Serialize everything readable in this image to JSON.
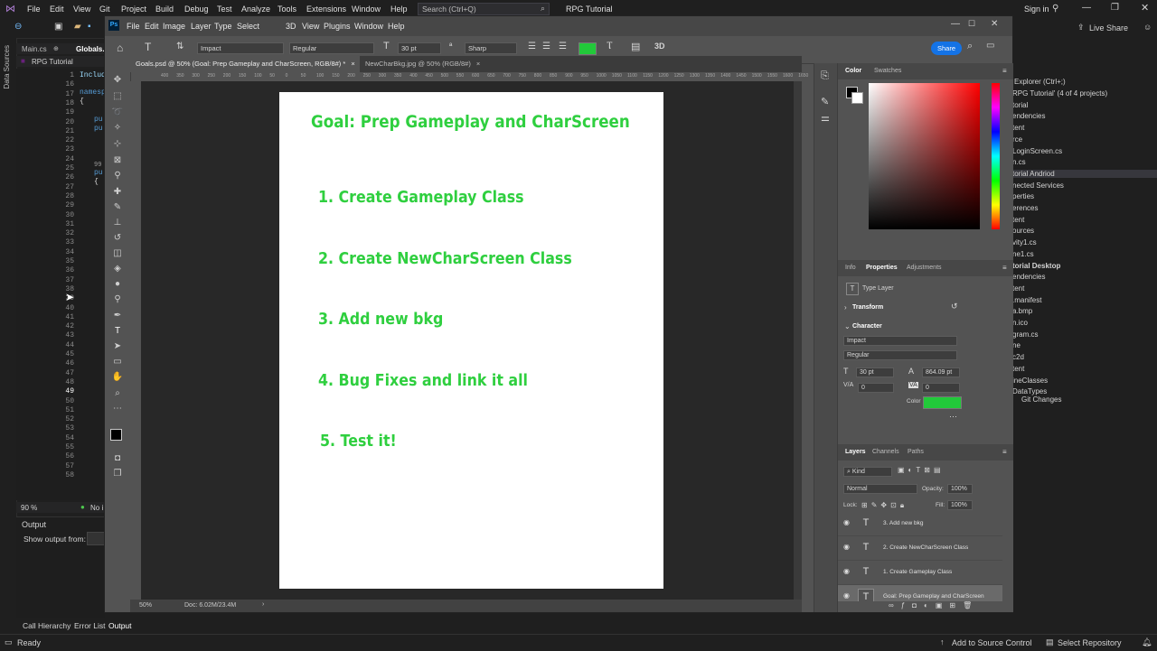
{
  "vs": {
    "menu": [
      "File",
      "Edit",
      "View",
      "Git",
      "Project",
      "Build",
      "Debug",
      "Test",
      "Analyze",
      "Tools",
      "Extensions",
      "Window",
      "Help"
    ],
    "search_placeholder": "Search (Ctrl+Q)",
    "title": "RPG Tutorial",
    "sign_in": "Sign in",
    "live_share": "Live Share",
    "left_strip_label": "Data Sources",
    "editor_tabs": [
      "Main.cs",
      "Globals.c"
    ],
    "file_dropdown": "RPG Tutorial",
    "code_fragments": {
      "include": "Includ",
      "namespace": "namesp",
      "brace_open": "{",
      "pu1": "pu",
      "pu2": "pu",
      "n99": "99",
      "pu3": "pu",
      "brace2": "{"
    },
    "line_numbers": [
      "1",
      "16",
      "17",
      "18",
      "19",
      "20",
      "21",
      "22",
      "23",
      "24",
      "25",
      "26",
      "27",
      "28",
      "29",
      "30",
      "31",
      "32",
      "33",
      "34",
      "35",
      "36",
      "37",
      "38",
      "39",
      "40",
      "41",
      "42",
      "43",
      "44",
      "45",
      "46",
      "47",
      "48",
      "49",
      "50",
      "51",
      "52",
      "53",
      "54",
      "55",
      "56",
      "57",
      "58"
    ],
    "zoom": "90 %",
    "issues": "No i",
    "output_title": "Output",
    "output_from": "Show output from:",
    "bottom_tabs": [
      "Call Hierarchy",
      "Error List",
      "Output"
    ],
    "status_ready": "Ready",
    "add_source": "Add to Source Control",
    "select_repo": "Select Repository",
    "solution_search": "Explorer (Ctrl+;)",
    "solution_items": [
      "RPG Tutorial' (4 of 4 projects)",
      "torial",
      "endencies",
      "tent",
      "rce",
      "LoginScreen.cs",
      "n.cs",
      "torial Andriod",
      "nected Services",
      "perties",
      "erences",
      "tent",
      "ources",
      "vity1.cs",
      "ne1.cs",
      "torial Desktop",
      "endencies",
      "tent",
      ".manifest",
      "a.bmp",
      "n.ico",
      "gram.cs",
      "ne",
      "c2d",
      "tent",
      "ineClasses",
      "DataTypes"
    ],
    "git_changes": "Git Changes"
  },
  "ps": {
    "menu": [
      "File",
      "Edit",
      "Image",
      "Layer",
      "Type",
      "Select",
      "3D",
      "View",
      "Plugins",
      "Window",
      "Help"
    ],
    "options": {
      "font": "Impact",
      "style": "Regular",
      "size": "30 pt",
      "aa": "Sharp",
      "share": "Share",
      "color": "#22c93a"
    },
    "doc_tabs": [
      {
        "label": "Goals.psd @ 50% (Goal: Prep Gameplay and CharScreen, RGB/8#) *",
        "close": "×"
      },
      {
        "label": "NewCharBkg.jpg @ 50% (RGB/8#)",
        "close": "×"
      }
    ],
    "ruler_ticks": [
      "400",
      "350",
      "300",
      "250",
      "200",
      "150",
      "100",
      "50",
      "0",
      "50",
      "100",
      "150",
      "200",
      "250",
      "300",
      "350",
      "400",
      "450",
      "500",
      "550",
      "600",
      "650",
      "700",
      "750",
      "800",
      "850",
      "900",
      "950",
      "1000",
      "1050",
      "1100",
      "1150",
      "1200",
      "1250",
      "1300",
      "1350",
      "1400",
      "1450",
      "1500",
      "1550",
      "1600",
      "1650",
      "1700"
    ],
    "document": {
      "heading": "Goal: Prep Gameplay and CharScreen",
      "items": [
        "1. Create Gameplay Class",
        "2. Create NewCharScreen Class",
        "3. Add new bkg",
        "4. Bug Fixes and link it all",
        "5. Test it!"
      ],
      "text_color": "#2fcf3f"
    },
    "status": {
      "zoom": "50%",
      "doc": "Doc: 6.02M/23.4M"
    },
    "color_panel": {
      "tabs": [
        "Color",
        "Swatches"
      ],
      "hue": "#ff0000"
    },
    "properties": {
      "tabs": [
        "Info",
        "Properties",
        "Adjustments"
      ],
      "type_layer": "Type Layer",
      "transform": "Transform",
      "character": "Character",
      "font": "Impact",
      "style": "Regular",
      "size": "30 pt",
      "leading": "864.09 pt",
      "tracking_va": "0",
      "tracking": "0",
      "color_label": "Color",
      "color": "#22c93a"
    },
    "layers": {
      "tabs": [
        "Layers",
        "Channels",
        "Paths"
      ],
      "kind": "Kind",
      "blend": "Normal",
      "opacity_label": "Opacity:",
      "opacity": "100%",
      "lock_label": "Lock:",
      "fill_label": "Fill:",
      "fill": "100%",
      "items": [
        "3. Add new bkg",
        "2. Create NewCharScreen Class",
        "1. Create Gameplay Class",
        "Goal: Prep Gameplay and CharScreen"
      ]
    }
  }
}
